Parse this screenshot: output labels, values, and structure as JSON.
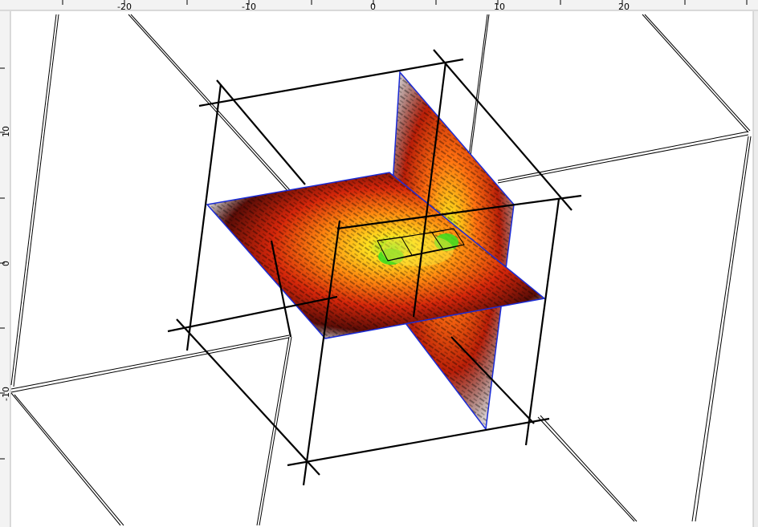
{
  "ruler": {
    "x_ticks": [
      "-20",
      "-10",
      "0",
      "10",
      "20"
    ],
    "y_ticks": [
      "10",
      "0",
      "-10"
    ]
  },
  "colors": {
    "background": "#ffffff",
    "frame_lines": "#000000",
    "slice_border": "#1a2bd6",
    "heat_low": "#3a0a05",
    "heat_mid": "#e0340a",
    "heat_high": "#ffd21a",
    "heat_peak": "#28e010"
  },
  "viewport": {
    "content": "3D volume view with orthogonal heat-map slices"
  }
}
